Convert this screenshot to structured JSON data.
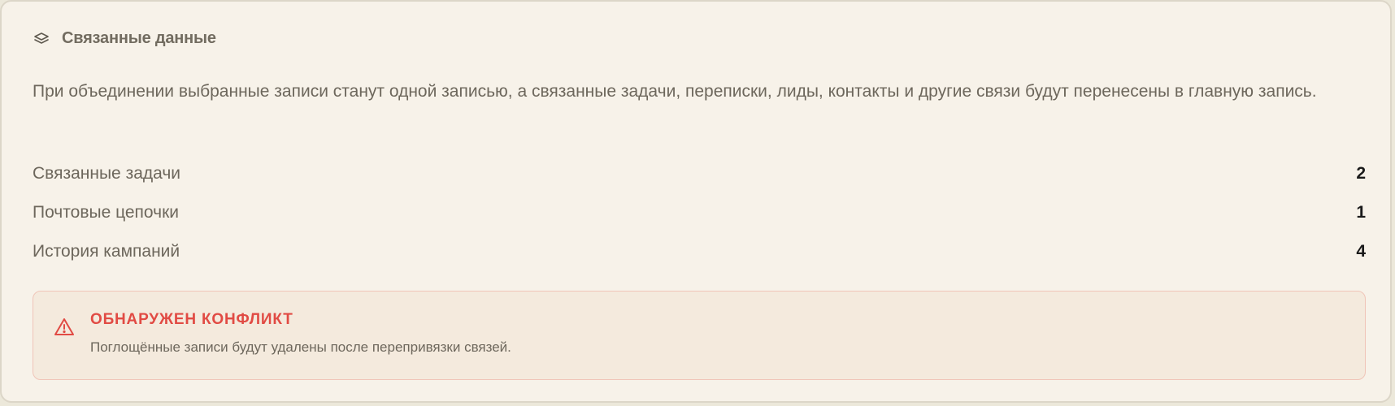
{
  "section": {
    "icon": "layers-icon",
    "title": "Связанные данные",
    "description": "При объединении выбранные записи станут одной записью, а связанные задачи, переписки, лиды, контакты и другие связи будут перенесены в главную запись."
  },
  "stats": [
    {
      "label": "Связанные задачи",
      "value": "2"
    },
    {
      "label": "Почтовые цепочки",
      "value": "1"
    },
    {
      "label": "История кампаний",
      "value": "4"
    }
  ],
  "alert": {
    "icon": "warning-triangle-icon",
    "title": "ОБНАРУЖЕН КОНФЛИКТ",
    "text": "Поглощённые записи будут удалены после перепривязки связей.",
    "color": "#e14b44"
  },
  "colors": {
    "card_background": "#f7f2e9",
    "alert_background": "#f4eadd",
    "alert_border": "#f0c5b8",
    "muted_text": "#6d675c"
  }
}
